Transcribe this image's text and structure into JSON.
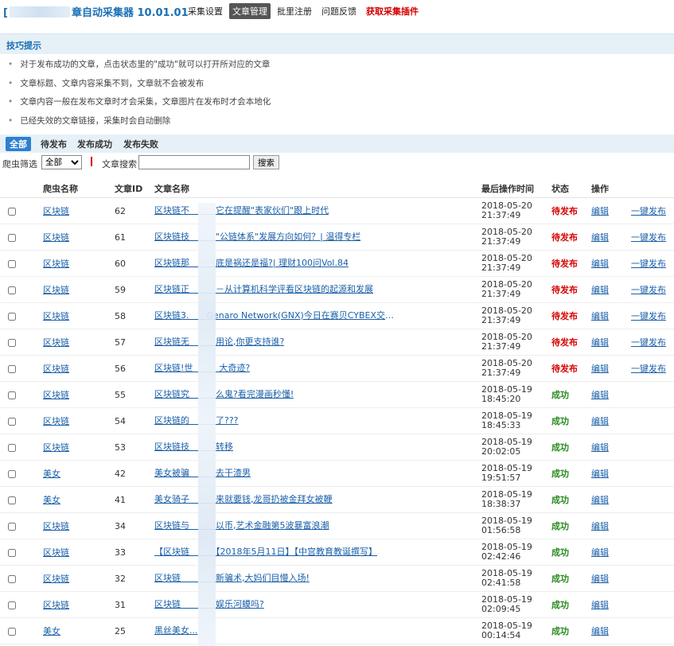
{
  "app": {
    "title_prefix": "[",
    "title_suffix": "章自动采集器 10.01.01"
  },
  "nav": [
    {
      "label": "采集设置",
      "state": "normal"
    },
    {
      "label": "文章管理",
      "state": "active"
    },
    {
      "label": "批里注册",
      "state": "normal"
    },
    {
      "label": "问题反馈",
      "state": "normal"
    },
    {
      "label": "获取采集插件",
      "state": "highlight"
    }
  ],
  "tips": {
    "header": "技巧提示",
    "items": [
      "对于发布成功的文章，点击状态里的\"成功\"就可以打开所对应的文章",
      "文章标题、文章内容采集不到，文章就不会被发布",
      "文章内容一般在发布文章时才会采集，文章图片在发布时才会本地化",
      "已经失效的文章链接，采集时会自动删除"
    ]
  },
  "filter_tabs": [
    {
      "label": "全部",
      "active": true
    },
    {
      "label": "待发布",
      "active": false
    },
    {
      "label": "发布成功",
      "active": false
    },
    {
      "label": "发布失败",
      "active": false
    }
  ],
  "search": {
    "crawler_filter_label": "爬虫筛选",
    "crawler_filter_value": "全部",
    "article_search_label": "文章搜索",
    "article_search_value": "",
    "search_button": "搜索"
  },
  "table": {
    "headers": {
      "crawler": "爬虫名称",
      "id": "文章ID",
      "title": "文章名称",
      "time": "最后操作时间",
      "status": "状态",
      "action": "操作"
    },
    "edit_label": "编辑",
    "publish_label": "一键发布",
    "rows": [
      {
        "crawler": "区块链",
        "id": "62",
        "title": "区块链不　　　它在提醒\"表家伙们\"跟上时代",
        "date": "2018-05-20",
        "clock": "21:37:49",
        "status": "待发布",
        "pending": true
      },
      {
        "crawler": "区块链",
        "id": "61",
        "title": "区块链技　　　\"公链体系\"发展方向如何？| 温得专栏",
        "date": "2018-05-20",
        "clock": "21:37:49",
        "status": "待发布",
        "pending": true
      },
      {
        "crawler": "区块链",
        "id": "60",
        "title": "区块链那　　　底是祸还是福?| 理财100问Vol.84",
        "date": "2018-05-20",
        "clock": "21:37:49",
        "status": "待发布",
        "pending": true
      },
      {
        "crawler": "区块链",
        "id": "59",
        "title": "区块链正　　　－从计算机科学评看区块链的起源和发展",
        "date": "2018-05-20",
        "clock": "21:37:49",
        "status": "待发布",
        "pending": true
      },
      {
        "crawler": "区块链",
        "id": "58",
        "title": "区块链3.　　Genaro Network(GNX)今日在赛贝CYBEX交易所...",
        "date": "2018-05-20",
        "clock": "21:37:49",
        "status": "待发布",
        "pending": true
      },
      {
        "crawler": "区块链",
        "id": "57",
        "title": "区块链无　　　用论,你更支持谁?",
        "date": "2018-05-20",
        "clock": "21:37:49",
        "status": "待发布",
        "pending": true
      },
      {
        "crawler": "区块链",
        "id": "56",
        "title": "区块链!世　　　大奇迹?",
        "date": "2018-05-20",
        "clock": "21:37:49",
        "status": "待发布",
        "pending": true
      },
      {
        "crawler": "区块链",
        "id": "55",
        "title": "区块链究　　　么鬼?看完漫画秒懂!",
        "date": "2018-05-19",
        "clock": "18:45:20",
        "status": "成功",
        "pending": false
      },
      {
        "crawler": "区块链",
        "id": "54",
        "title": "区块链的　　　了???",
        "date": "2018-05-19",
        "clock": "18:45:33",
        "status": "成功",
        "pending": false
      },
      {
        "crawler": "区块链",
        "id": "53",
        "title": "区块链技　　　转移",
        "date": "2018-05-19",
        "clock": "20:02:05",
        "status": "成功",
        "pending": false
      },
      {
        "crawler": "美女",
        "id": "42",
        "title": "美女被骗　　　去干渣男",
        "date": "2018-05-19",
        "clock": "19:51:57",
        "status": "成功",
        "pending": false
      },
      {
        "crawler": "美女",
        "id": "41",
        "title": "美女骑子　　　来就要钱,龙哥扔被金拜女被鞭",
        "date": "2018-05-19",
        "clock": "18:38:37",
        "status": "成功",
        "pending": false
      },
      {
        "crawler": "区块链",
        "id": "34",
        "title": "区块链与　　　以币,艺术金融第5波暴富浪潮",
        "date": "2018-05-19",
        "clock": "01:56:58",
        "status": "成功",
        "pending": false
      },
      {
        "crawler": "区块链",
        "id": "33",
        "title": "【区块链　　　【2018年5月11日】【中宫教育教诞撰写】",
        "date": "2018-05-19",
        "clock": "02:42:46",
        "status": "成功",
        "pending": false
      },
      {
        "crawler": "区块链",
        "id": "32",
        "title": "区块链　　　　新骗术,大妈们目慢入场!",
        "date": "2018-05-19",
        "clock": "02:41:58",
        "status": "成功",
        "pending": false
      },
      {
        "crawler": "区块链",
        "id": "31",
        "title": "区块链　　　　娱乐河蟆吗?",
        "date": "2018-05-19",
        "clock": "02:09:45",
        "status": "成功",
        "pending": false
      },
      {
        "crawler": "美女",
        "id": "25",
        "title": "黑丝美女...",
        "date": "2018-05-19",
        "clock": "00:14:54",
        "status": "成功",
        "pending": false
      }
    ]
  },
  "colors": {
    "accent": "#1a6fb5",
    "pending": "#d40000",
    "success": "#2a8a1f",
    "tab_active": "#2d7fd1",
    "nav_active": "#555555"
  }
}
